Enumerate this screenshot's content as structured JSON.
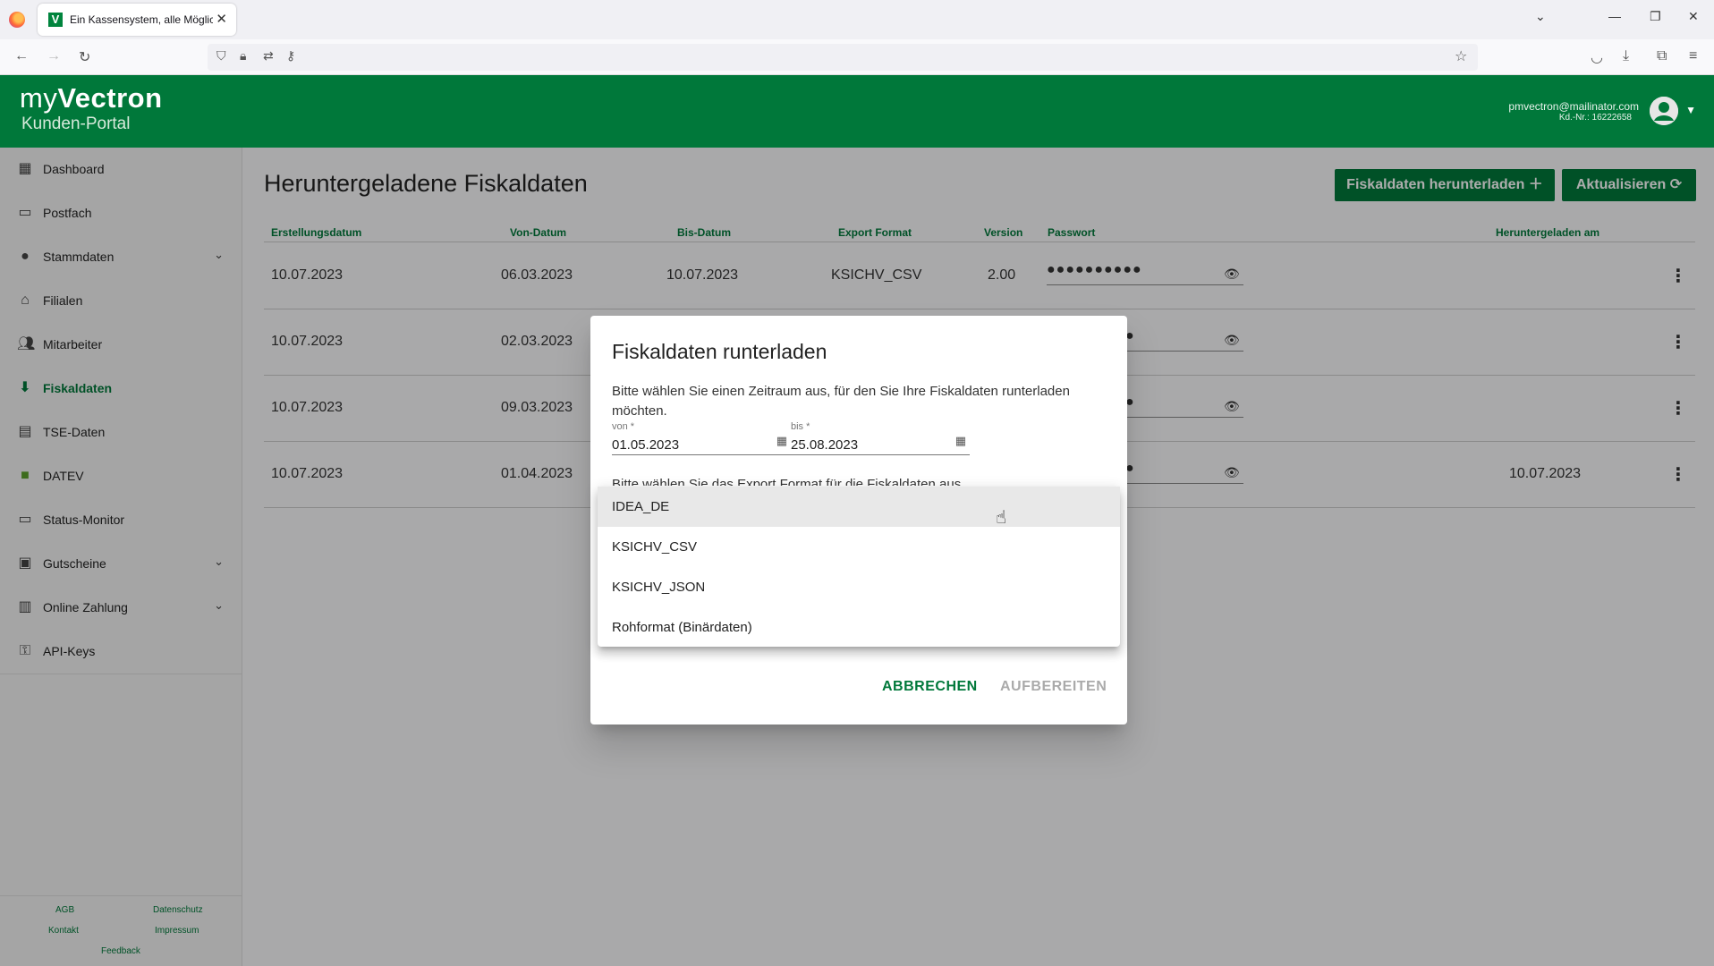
{
  "browser": {
    "tab_title": "Ein Kassensystem, alle Möglichk",
    "tab_favicon": "V"
  },
  "header": {
    "logo_my": "my",
    "logo_vectron": "Vectron",
    "logo_subtitle": "Kunden-Portal",
    "user_email": "pmvectron@mailinator.com",
    "user_kd": "Kd.-Nr.: 16222658"
  },
  "sidebar": {
    "items": [
      {
        "label": "Dashboard",
        "icon": "dashboard-icon"
      },
      {
        "label": "Postfach",
        "icon": "inbox-icon"
      },
      {
        "label": "Stammdaten",
        "icon": "person-icon"
      },
      {
        "label": "Filialen",
        "icon": "store-icon"
      },
      {
        "label": "Mitarbeiter",
        "icon": "people-icon"
      },
      {
        "label": "Fiskaldaten",
        "icon": "download-icon"
      },
      {
        "label": "TSE-Daten",
        "icon": "tse-icon"
      },
      {
        "label": "DATEV",
        "icon": "datev-icon"
      },
      {
        "label": "Status-Monitor",
        "icon": "monitor-icon"
      },
      {
        "label": "Gutscheine",
        "icon": "gift-icon"
      },
      {
        "label": "Online Zahlung",
        "icon": "payment-icon"
      },
      {
        "label": "API-Keys",
        "icon": "key-icon"
      }
    ],
    "footer": {
      "agb": "AGB",
      "datenschutz": "Datenschutz",
      "kontakt": "Kontakt",
      "impressum": "Impressum",
      "feedback": "Feedback"
    }
  },
  "main": {
    "title": "Heruntergeladene Fiskaldaten",
    "btn_download": "Fiskaldaten herunterladen",
    "btn_refresh": "Aktualisieren",
    "columns": [
      "Erstellungsdatum",
      "Von-Datum",
      "Bis-Datum",
      "Export Format",
      "Version",
      "Passwort",
      "Heruntergeladen am"
    ],
    "rows": [
      {
        "created": "10.07.2023",
        "from": "06.03.2023",
        "to": "10.07.2023",
        "format": "KSICHV_CSV",
        "version": "2.00",
        "password": "●●●●●●●●●●",
        "downloaded": ""
      },
      {
        "created": "10.07.2023",
        "from": "02.03.2023",
        "password": "●",
        "downloaded": ""
      },
      {
        "created": "10.07.2023",
        "from": "09.03.2023",
        "password": "●",
        "downloaded": ""
      },
      {
        "created": "10.07.2023",
        "from": "01.04.2023",
        "password": "●",
        "downloaded": "10.07.2023"
      }
    ]
  },
  "dialog": {
    "title": "Fiskaldaten runterladen",
    "text": "Bitte wählen Sie einen Zeitraum aus, für den Sie Ihre Fiskaldaten runterladen möchten.",
    "von_label": "von *",
    "von_value": "01.05.2023",
    "bis_label": "bis *",
    "bis_value": "25.08.2023",
    "text2": "Bitte wählen Sie das Export Format für die Fiskaldaten aus",
    "cancel": "ABBRECHEN",
    "submit": "AUFBEREITEN",
    "options": [
      "IDEA_DE",
      "KSICHV_CSV",
      "KSICHV_JSON",
      "Rohformat (Binärdaten)"
    ],
    "hovered_option": "IDEA_DE"
  },
  "colors": {
    "brand_green": "#00783a",
    "disabled": "#aaaaaa"
  }
}
